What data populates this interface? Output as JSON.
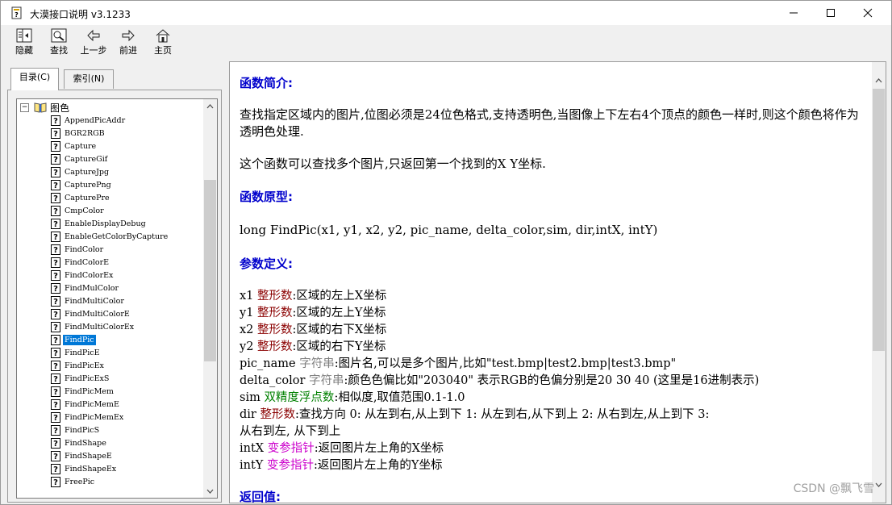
{
  "window": {
    "title": "大漠接口说明 v3.1233"
  },
  "toolbar": {
    "buttons": [
      {
        "label": "隐藏",
        "icon": "hide-icon"
      },
      {
        "label": "查找",
        "icon": "find-icon"
      },
      {
        "label": "上一步",
        "icon": "back-arrow-icon"
      },
      {
        "label": "前进",
        "icon": "forward-arrow-icon"
      },
      {
        "label": "主页",
        "icon": "home-icon"
      }
    ]
  },
  "tabs": {
    "contents": "目录(C)",
    "index": "索引(N)"
  },
  "tree": {
    "root": {
      "expander": "−",
      "label": "图色"
    },
    "items": [
      "AppendPicAddr",
      "BGR2RGB",
      "Capture",
      "CaptureGif",
      "CaptureJpg",
      "CapturePng",
      "CapturePre",
      "CmpColor",
      "EnableDisplayDebug",
      "EnableGetColorByCapture",
      "FindColor",
      "FindColorE",
      "FindColorEx",
      "FindMulColor",
      "FindMultiColor",
      "FindMultiColorE",
      "FindMultiColorEx",
      "FindPic",
      "FindPicE",
      "FindPicEx",
      "FindPicExS",
      "FindPicMem",
      "FindPicMemE",
      "FindPicMemEx",
      "FindPicS",
      "FindShape",
      "FindShapeE",
      "FindShapeEx",
      "FreePic"
    ],
    "selected": "FindPic",
    "help_glyph": "?"
  },
  "content": {
    "intro_heading": "函数简介:",
    "intro_p1": "查找指定区域内的图片,位图必须是24位色格式,支持透明色,当图像上下左右4个顶点的颜色一样时,则这个颜色将作为透明色处理.",
    "intro_p2": "这个函数可以查找多个图片,只返回第一个找到的X Y坐标.",
    "proto_heading": "函数原型:",
    "prototype": "long FindPic(x1, y1, x2, y2, pic_name, delta_color,sim, dir,intX, intY)",
    "params_heading": "参数定义:",
    "params": [
      {
        "name": "x1 ",
        "type": "整形数",
        "kind": "int",
        "desc": ":区域的左上X坐标"
      },
      {
        "name": "y1 ",
        "type": "整形数",
        "kind": "int",
        "desc": ":区域的左上Y坐标"
      },
      {
        "name": "x2 ",
        "type": "整形数",
        "kind": "int",
        "desc": ":区域的右下X坐标"
      },
      {
        "name": "y2 ",
        "type": "整形数",
        "kind": "int",
        "desc": ":区域的右下Y坐标"
      },
      {
        "name": "pic_name ",
        "type": "字符串",
        "kind": "str",
        "desc": ":图片名,可以是多个图片,比如\"test.bmp|test2.bmp|test3.bmp\""
      },
      {
        "name": "delta_color ",
        "type": "字符串",
        "kind": "str",
        "desc": ":颜色色偏比如\"203040\" 表示RGB的色偏分别是20 30 40 (这里是16进制表示)"
      },
      {
        "name": "sim ",
        "type": "双精度浮点数",
        "kind": "dbl",
        "desc": ":相似度,取值范围0.1-1.0"
      },
      {
        "name": "dir ",
        "type": "整形数",
        "kind": "int",
        "desc": ":查找方向 0: 从左到右,从上到下 1: 从左到右,从下到上 2: 从右到左,从上到下 3:"
      },
      {
        "name": "intX ",
        "type": "变参指针",
        "kind": "ptr",
        "desc": ":返回图片左上角的X坐标"
      },
      {
        "name": "intY ",
        "type": "变参指针",
        "kind": "ptr",
        "desc": ":返回图片左上角的Y坐标"
      }
    ],
    "dir_continuation": "从右到左, 从下到上",
    "return_heading": "返回值:"
  },
  "watermark": "CSDN @飘飞雪",
  "colors": {
    "heading": "#0000cc",
    "int_type": "#8b0000",
    "str_type": "#808080",
    "double_type": "#008000",
    "pointer_type": "#cc00cc",
    "selection": "#0078d7"
  }
}
